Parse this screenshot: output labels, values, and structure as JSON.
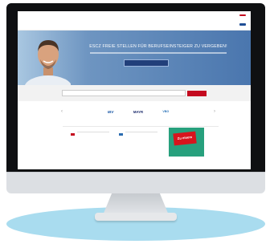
{
  "topbar": {
    "brand": "",
    "links": [
      "",
      ""
    ],
    "cta": ""
  },
  "navbar": {
    "logo_main": "",
    "logo_sub": "",
    "items": [
      "",
      "",
      "",
      ""
    ],
    "cta": ""
  },
  "hero": {
    "headline": "ESCZ FREIE STELLEN FÜR BERUFSEINSTEIGER ZU VERGEBEN!",
    "button": ""
  },
  "search": {
    "placeholder": "",
    "button": ""
  },
  "partners": {
    "title": "",
    "logos": [
      "",
      "IBV",
      "MAYR",
      "VBG",
      ""
    ]
  },
  "listings": {
    "title": "",
    "jobs": [
      {
        "title": "",
        "meta": ""
      },
      {
        "title": "",
        "meta": ""
      }
    ],
    "ad_text": "Zu einem"
  },
  "colors": {
    "brand_red": "#c40a1f",
    "nav_blue": "#1f4f96",
    "ad_green": "#27a07d",
    "stand_blue": "#a9dcef"
  }
}
